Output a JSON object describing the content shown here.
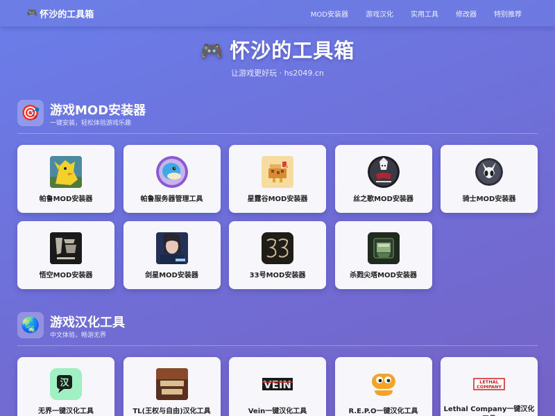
{
  "nav": {
    "brand_icon": "🎮",
    "brand": "怀沙的工具箱",
    "links": [
      "MOD安装器",
      "游戏汉化",
      "实用工具",
      "修改器",
      "特别推荐"
    ]
  },
  "hero": {
    "icon": "🎮",
    "title": "怀沙的工具箱",
    "subtitle": "让游戏更好玩 · hs2049.cn"
  },
  "sections": [
    {
      "icon": "🎯",
      "title": "游戏MOD安装器",
      "subtitle": "一键安装，轻松体验游戏乐趣",
      "items": [
        {
          "label": "帕鲁MOD安装器",
          "thumb": "yellow-creature"
        },
        {
          "label": "帕鲁服务器管理工具",
          "thumb": "blue-creature"
        },
        {
          "label": "星露谷MOD安装器",
          "thumb": "pixel-chicken"
        },
        {
          "label": "丝之歌MOD安装器",
          "thumb": "silksong-logo"
        },
        {
          "label": "骑士MOD安装器",
          "thumb": "knight-mask"
        },
        {
          "label": "悟空MOD安装器",
          "thumb": "wukong-cover"
        },
        {
          "label": "剑星MOD安装器",
          "thumb": "stellar-blade-cover"
        },
        {
          "label": "33号MOD安装器",
          "thumb": "33-logo"
        },
        {
          "label": "杀戮尖塔MOD安装器",
          "thumb": "slay-the-spire-icon"
        }
      ]
    },
    {
      "icon": "🌏",
      "title": "游戏汉化工具",
      "subtitle": "中文体验，畅游无界",
      "items": [
        {
          "label": "无界一键汉化工具",
          "thumb": "chinese-translate-icon"
        },
        {
          "label": "TL(王权与自由)汉化工具",
          "thumb": "throne-liberty-cover"
        },
        {
          "label": "Vein一键汉化工具",
          "thumb": "vein-logo"
        },
        {
          "label": "R.E.P.O一键汉化工具",
          "thumb": "repo-robot-icon"
        },
        {
          "label": "Lethal Company一键汉化工具",
          "thumb": "lethal-company-logo"
        }
      ]
    }
  ]
}
